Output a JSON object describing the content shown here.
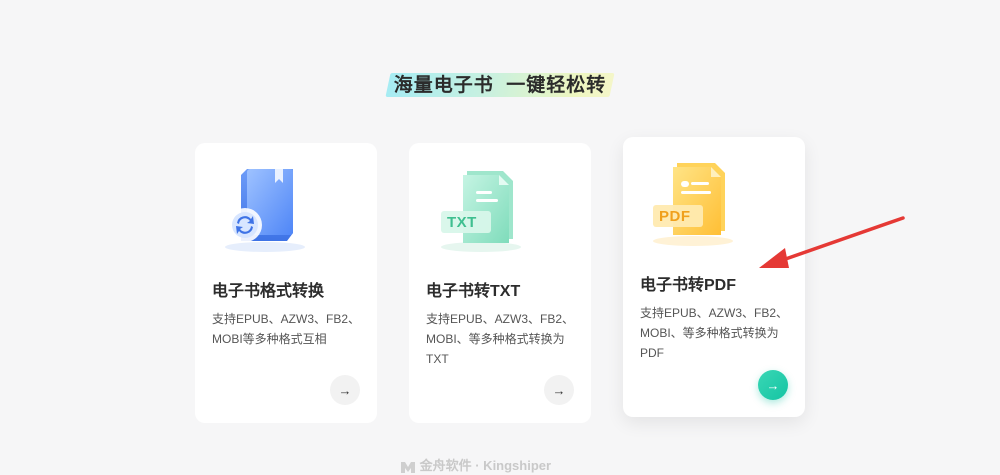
{
  "section": {
    "heading": "海量电子书  一键轻松转"
  },
  "cards": [
    {
      "icon": "ebook-convert-icon",
      "title": "电子书格式转换",
      "description": "支持EPUB、AZW3、FB2、MOBI等多种格式互相",
      "arrow": "→"
    },
    {
      "icon": "txt-file-icon",
      "icon_label": "TXT",
      "title": "电子书转TXT",
      "description": "支持EPUB、AZW3、FB2、MOBI、等多种格式转换为TXT",
      "arrow": "→"
    },
    {
      "icon": "pdf-file-icon",
      "icon_label": "PDF",
      "title": "电子书转PDF",
      "description": "支持EPUB、AZW3、FB2、MOBI、等多种格式转换为PDF",
      "arrow": "→"
    }
  ],
  "annotation": {
    "icon": "red-arrow-icon",
    "color": "#e53935"
  },
  "footer": {
    "logo_text": "金舟软件 · Kingshiper"
  },
  "colors": {
    "accent_green": "#14c4a3",
    "card_bg": "#ffffff",
    "page_bg": "#f6f6f7"
  }
}
